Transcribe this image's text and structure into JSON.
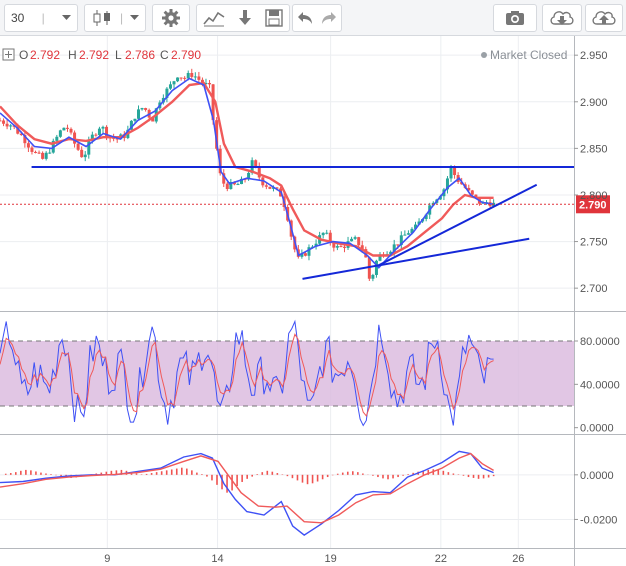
{
  "toolbar": {
    "interval": "30",
    "icons": [
      "chevron-down-icon",
      "candlestick-icon",
      "chevron-down-icon",
      "gear-icon",
      "indicators-icon",
      "compare-icon",
      "save-icon",
      "undo-icon",
      "redo-icon",
      "camera-icon",
      "cloud-download-icon",
      "cloud-upload-icon"
    ]
  },
  "legend": {
    "o_label": "O",
    "o_value": "2.792",
    "h_label": "H",
    "h_value": "2.792",
    "l_label": "L",
    "l_value": "2.786",
    "c_label": "C",
    "c_value": "2.790"
  },
  "status": "Market Closed",
  "colors": {
    "up": "#26a69a",
    "down": "#ef5350",
    "ema": "#f05a5a",
    "sma": "#3f51f5",
    "trendline": "#1428d8",
    "rsi_band": "#d9b8dd",
    "price_line": "#e0343b"
  },
  "chart_data": [
    {
      "type": "candlestick",
      "name": "price",
      "x_ticks": [
        "9",
        "14",
        "19",
        "22",
        "26"
      ],
      "y_ticks": [
        "2.950",
        "2.900",
        "2.850",
        "2.800",
        "2.750",
        "2.700"
      ],
      "ylim": [
        2.683,
        2.962
      ],
      "last_price": "2.790",
      "trendlines": [
        {
          "from": [
            0.055,
            2.83
          ],
          "to": [
            1.0,
            2.83
          ]
        },
        {
          "from": [
            0.527,
            2.71
          ],
          "to": [
            0.922,
            2.753
          ]
        },
        {
          "from": [
            0.658,
            2.724
          ],
          "to": [
            0.935,
            2.811
          ]
        }
      ],
      "close_path": [
        [
          0.0,
          2.88
        ],
        [
          0.02,
          2.875
        ],
        [
          0.04,
          2.862
        ],
        [
          0.06,
          2.845
        ],
        [
          0.075,
          2.838
        ],
        [
          0.09,
          2.852
        ],
        [
          0.105,
          2.868
        ],
        [
          0.115,
          2.875
        ],
        [
          0.13,
          2.855
        ],
        [
          0.145,
          2.84
        ],
        [
          0.16,
          2.862
        ],
        [
          0.175,
          2.875
        ],
        [
          0.19,
          2.862
        ],
        [
          0.205,
          2.86
        ],
        [
          0.22,
          2.865
        ],
        [
          0.235,
          2.885
        ],
        [
          0.25,
          2.895
        ],
        [
          0.265,
          2.88
        ],
        [
          0.28,
          2.905
        ],
        [
          0.295,
          2.915
        ],
        [
          0.31,
          2.93
        ],
        [
          0.32,
          2.925
        ],
        [
          0.335,
          2.93
        ],
        [
          0.35,
          2.922
        ],
        [
          0.365,
          2.915
        ],
        [
          0.375,
          2.86
        ],
        [
          0.385,
          2.815
        ],
        [
          0.395,
          2.81
        ],
        [
          0.41,
          2.81
        ],
        [
          0.425,
          2.815
        ],
        [
          0.44,
          2.835
        ],
        [
          0.455,
          2.815
        ],
        [
          0.47,
          2.808
        ],
        [
          0.48,
          2.805
        ],
        [
          0.49,
          2.8
        ],
        [
          0.5,
          2.78
        ],
        [
          0.51,
          2.748
        ],
        [
          0.52,
          2.73
        ],
        [
          0.535,
          2.74
        ],
        [
          0.55,
          2.75
        ],
        [
          0.565,
          2.76
        ],
        [
          0.575,
          2.75
        ],
        [
          0.59,
          2.742
        ],
        [
          0.605,
          2.748
        ],
        [
          0.62,
          2.752
        ],
        [
          0.635,
          2.74
        ],
        [
          0.645,
          2.705
        ],
        [
          0.655,
          2.728
        ],
        [
          0.665,
          2.738
        ],
        [
          0.68,
          2.742
        ],
        [
          0.695,
          2.75
        ],
        [
          0.71,
          2.76
        ],
        [
          0.725,
          2.765
        ],
        [
          0.74,
          2.78
        ],
        [
          0.755,
          2.795
        ],
        [
          0.765,
          2.8
        ],
        [
          0.775,
          2.808
        ],
        [
          0.785,
          2.83
        ],
        [
          0.795,
          2.818
        ],
        [
          0.81,
          2.808
        ],
        [
          0.82,
          2.8
        ],
        [
          0.83,
          2.795
        ],
        [
          0.84,
          2.79
        ],
        [
          0.85,
          2.793
        ],
        [
          0.86,
          2.79
        ]
      ],
      "ema_path": [
        [
          0.0,
          2.895
        ],
        [
          0.03,
          2.875
        ],
        [
          0.06,
          2.86
        ],
        [
          0.09,
          2.855
        ],
        [
          0.12,
          2.86
        ],
        [
          0.15,
          2.858
        ],
        [
          0.18,
          2.862
        ],
        [
          0.21,
          2.862
        ],
        [
          0.24,
          2.872
        ],
        [
          0.27,
          2.885
        ],
        [
          0.3,
          2.9
        ],
        [
          0.33,
          2.918
        ],
        [
          0.355,
          2.92
        ],
        [
          0.375,
          2.9
        ],
        [
          0.39,
          2.855
        ],
        [
          0.41,
          2.83
        ],
        [
          0.44,
          2.825
        ],
        [
          0.47,
          2.818
        ],
        [
          0.49,
          2.81
        ],
        [
          0.51,
          2.785
        ],
        [
          0.53,
          2.762
        ],
        [
          0.56,
          2.752
        ],
        [
          0.59,
          2.748
        ],
        [
          0.62,
          2.745
        ],
        [
          0.65,
          2.735
        ],
        [
          0.68,
          2.735
        ],
        [
          0.71,
          2.745
        ],
        [
          0.74,
          2.76
        ],
        [
          0.77,
          2.775
        ],
        [
          0.79,
          2.79
        ],
        [
          0.81,
          2.8
        ],
        [
          0.83,
          2.797
        ],
        [
          0.86,
          2.797
        ]
      ],
      "sma_path": [
        [
          0.0,
          2.888
        ],
        [
          0.03,
          2.872
        ],
        [
          0.06,
          2.852
        ],
        [
          0.09,
          2.85
        ],
        [
          0.12,
          2.862
        ],
        [
          0.15,
          2.852
        ],
        [
          0.18,
          2.866
        ],
        [
          0.21,
          2.86
        ],
        [
          0.24,
          2.88
        ],
        [
          0.27,
          2.89
        ],
        [
          0.3,
          2.912
        ],
        [
          0.33,
          2.925
        ],
        [
          0.355,
          2.918
        ],
        [
          0.372,
          2.88
        ],
        [
          0.385,
          2.825
        ],
        [
          0.4,
          2.812
        ],
        [
          0.43,
          2.818
        ],
        [
          0.46,
          2.815
        ],
        [
          0.49,
          2.803
        ],
        [
          0.505,
          2.77
        ],
        [
          0.52,
          2.735
        ],
        [
          0.55,
          2.745
        ],
        [
          0.58,
          2.75
        ],
        [
          0.61,
          2.748
        ],
        [
          0.64,
          2.735
        ],
        [
          0.66,
          2.722
        ],
        [
          0.69,
          2.742
        ],
        [
          0.72,
          2.76
        ],
        [
          0.75,
          2.785
        ],
        [
          0.78,
          2.808
        ],
        [
          0.8,
          2.818
        ],
        [
          0.82,
          2.8
        ],
        [
          0.84,
          2.792
        ],
        [
          0.86,
          2.79
        ]
      ]
    },
    {
      "type": "line",
      "name": "stochastic",
      "y_ticks": [
        "80.0000",
        "40.0000",
        "0.0000"
      ],
      "ylim": [
        -4,
        104
      ],
      "band": [
        20,
        80
      ]
    },
    {
      "type": "bar",
      "name": "macd",
      "y_ticks": [
        "0.0000",
        "-0.0200"
      ],
      "ylim": [
        -0.031,
        0.0165
      ],
      "histogram": [
        0.0005,
        0.0008,
        0.0012,
        0.0018,
        0.0022,
        0.002,
        0.0015,
        0.001,
        0.0006,
        0.0003,
        -0.0002,
        -0.0006,
        -0.001,
        -0.0014,
        -0.0012,
        -0.0008,
        -0.0004,
        0.0002,
        0.0006,
        0.001,
        0.0014,
        0.0018,
        0.002,
        0.0022,
        0.0018,
        0.0012,
        0.0006,
        0.0002,
        0.0004,
        0.0008,
        0.0012,
        0.0016,
        0.002,
        0.0024,
        0.0028,
        0.0032,
        0.0028,
        0.002,
        0.001,
        0.0003,
        -0.0008,
        -0.0025,
        -0.0045,
        -0.0065,
        -0.008,
        -0.007,
        -0.005,
        -0.0032,
        -0.0018,
        -0.0008,
        0.0003,
        0.0012,
        0.0018,
        0.0014,
        0.0008,
        0.0002,
        -0.0006,
        -0.0015,
        -0.0025,
        -0.0035,
        -0.0042,
        -0.0038,
        -0.003,
        -0.002,
        -0.001,
        -0.0002,
        0.0005,
        0.001,
        0.0014,
        0.0016,
        0.0012,
        0.0006,
        0.0001,
        -0.0004,
        -0.001,
        -0.0016,
        -0.002,
        -0.0016,
        -0.001,
        -0.0004,
        0.0003,
        0.0009,
        0.0014,
        0.0018,
        0.0022,
        0.0025,
        0.0022,
        0.0018,
        0.0012,
        0.0006,
        0.0002,
        -0.0004,
        -0.001,
        -0.0014,
        -0.0018,
        -0.0016,
        -0.0012,
        -0.0006
      ],
      "macd_path": [
        [
          0.0,
          -0.0035
        ],
        [
          0.04,
          -0.003
        ],
        [
          0.08,
          -0.0015
        ],
        [
          0.12,
          -0.0005
        ],
        [
          0.16,
          0.0
        ],
        [
          0.2,
          0.0
        ],
        [
          0.24,
          0.0015
        ],
        [
          0.28,
          0.003
        ],
        [
          0.32,
          0.008
        ],
        [
          0.35,
          0.0095
        ],
        [
          0.37,
          0.0075
        ],
        [
          0.39,
          -0.004
        ],
        [
          0.41,
          -0.011
        ],
        [
          0.43,
          -0.0165
        ],
        [
          0.46,
          -0.018
        ],
        [
          0.49,
          -0.012
        ],
        [
          0.51,
          -0.023
        ],
        [
          0.53,
          -0.027
        ],
        [
          0.56,
          -0.022
        ],
        [
          0.59,
          -0.016
        ],
        [
          0.62,
          -0.009
        ],
        [
          0.65,
          -0.0075
        ],
        [
          0.68,
          -0.008
        ],
        [
          0.71,
          -0.001
        ],
        [
          0.74,
          0.002
        ],
        [
          0.77,
          0.0055
        ],
        [
          0.8,
          0.0105
        ],
        [
          0.82,
          0.0095
        ],
        [
          0.84,
          0.003
        ],
        [
          0.86,
          0.001
        ]
      ],
      "signal_path": [
        [
          0.0,
          -0.0055
        ],
        [
          0.04,
          -0.004
        ],
        [
          0.08,
          -0.002
        ],
        [
          0.12,
          -0.001
        ],
        [
          0.16,
          -0.0003
        ],
        [
          0.2,
          0.0002
        ],
        [
          0.24,
          0.001
        ],
        [
          0.28,
          0.0025
        ],
        [
          0.32,
          0.006
        ],
        [
          0.35,
          0.0085
        ],
        [
          0.38,
          0.006
        ],
        [
          0.4,
          -0.001
        ],
        [
          0.42,
          -0.008
        ],
        [
          0.45,
          -0.014
        ],
        [
          0.48,
          -0.0145
        ],
        [
          0.5,
          -0.014
        ],
        [
          0.53,
          -0.021
        ],
        [
          0.56,
          -0.0215
        ],
        [
          0.59,
          -0.018
        ],
        [
          0.62,
          -0.0125
        ],
        [
          0.65,
          -0.009
        ],
        [
          0.68,
          -0.0085
        ],
        [
          0.71,
          -0.004
        ],
        [
          0.74,
          0.0
        ],
        [
          0.77,
          0.003
        ],
        [
          0.8,
          0.0075
        ],
        [
          0.82,
          0.0095
        ],
        [
          0.84,
          0.005
        ],
        [
          0.86,
          0.002
        ]
      ]
    }
  ]
}
